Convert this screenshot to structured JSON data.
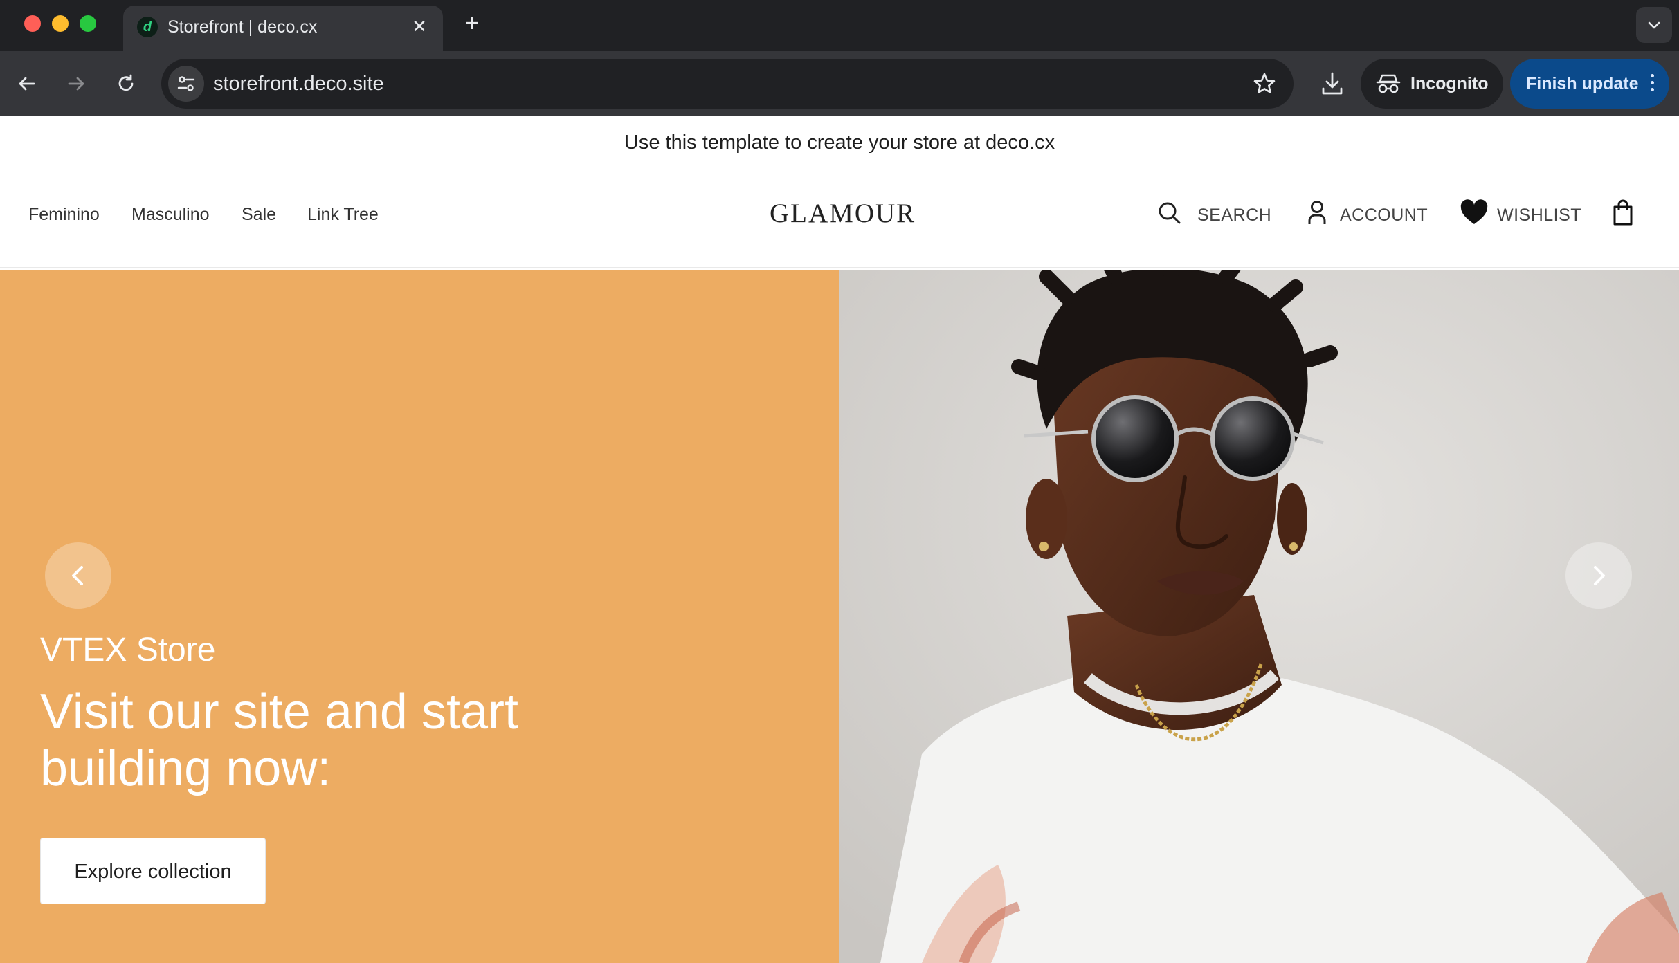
{
  "browser": {
    "tab": {
      "title": "Storefront | deco.cx",
      "favicon_icon": "deco-icon"
    },
    "url": "storefront.deco.site",
    "incognito_label": "Incognito",
    "finish_update_label": "Finish update"
  },
  "promo_bar": {
    "text": "Use this template to create your store at deco.cx"
  },
  "header": {
    "nav": [
      "Feminino",
      "Masculino",
      "Sale",
      "Link Tree"
    ],
    "logo": "GLAMOUR",
    "search_label": "SEARCH",
    "account_label": "ACCOUNT",
    "wishlist_label": "WISHLIST"
  },
  "hero": {
    "background_color": "#edac62",
    "eyebrow": "VTEX Store",
    "title": "Visit our site and start building now:",
    "cta_label": "Explore collection"
  }
}
